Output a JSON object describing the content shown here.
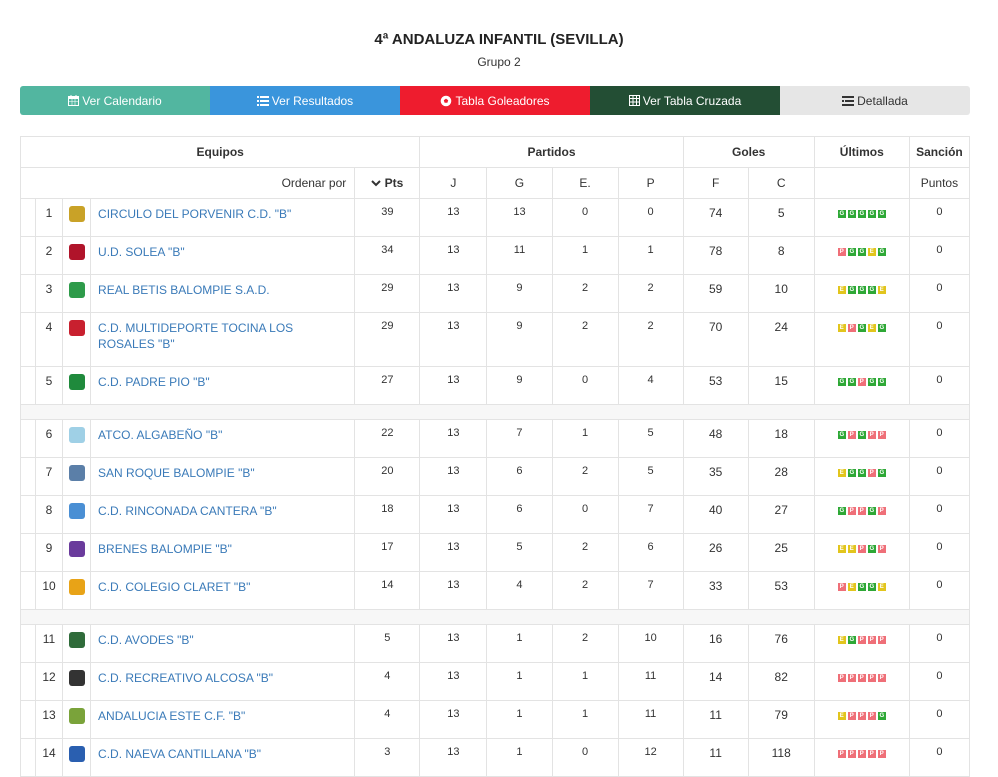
{
  "header": {
    "title": "4ª ANDALUZA INFANTIL (SEVILLA)",
    "subtitle": "Grupo 2"
  },
  "tabs": [
    {
      "label": "Ver Calendario",
      "icon": "calendar-icon",
      "color": "#52b6a0"
    },
    {
      "label": "Ver Resultados",
      "icon": "list-icon",
      "color": "#3a95dc"
    },
    {
      "label": "Tabla Goleadores",
      "icon": "soccer-ball-icon",
      "color": "#ee1c2e"
    },
    {
      "label": "Ver Tabla Cruzada",
      "icon": "grid-icon",
      "color": "#234e34"
    },
    {
      "label": "Detallada",
      "icon": "detail-list-icon",
      "color": "#e6e6e6"
    }
  ],
  "table_headers": {
    "equipos": "Equipos",
    "partidos": "Partidos",
    "goles": "Goles",
    "ultimos": "Últimos",
    "sancion": "Sanción",
    "ordenar": "Ordenar por",
    "pts": "Pts",
    "j": "J",
    "g": "G",
    "e": "E.",
    "p": "P",
    "f": "F",
    "c": "C",
    "puntos": "Puntos"
  },
  "result_colors": {
    "G": "#2ea836",
    "E": "#e2c51d",
    "P": "#ef6f78"
  },
  "teams": [
    {
      "pos": "1",
      "name": "CIRCULO DEL PORVENIR C.D. \"B\"",
      "pts": "39",
      "j": "13",
      "g": "13",
      "e": "0",
      "p": "0",
      "f": "74",
      "c": "5",
      "last": [
        "G",
        "G",
        "G",
        "G",
        "G"
      ],
      "sancion": "0",
      "crest": "#c9a227"
    },
    {
      "pos": "2",
      "name": "U.D. SOLEA \"B\"",
      "pts": "34",
      "j": "13",
      "g": "11",
      "e": "1",
      "p": "1",
      "f": "78",
      "c": "8",
      "last": [
        "P",
        "G",
        "G",
        "E",
        "G"
      ],
      "sancion": "0",
      "crest": "#b0142a"
    },
    {
      "pos": "3",
      "name": "REAL BETIS BALOMPIE S.A.D.",
      "pts": "29",
      "j": "13",
      "g": "9",
      "e": "2",
      "p": "2",
      "f": "59",
      "c": "10",
      "last": [
        "E",
        "G",
        "G",
        "G",
        "E"
      ],
      "sancion": "0",
      "crest": "#2e9b4a"
    },
    {
      "pos": "4",
      "name": "C.D. MULTIDEPORTE TOCINA LOS ROSALES \"B\"",
      "pts": "29",
      "j": "13",
      "g": "9",
      "e": "2",
      "p": "2",
      "f": "70",
      "c": "24",
      "last": [
        "E",
        "P",
        "G",
        "E",
        "G"
      ],
      "sancion": "0",
      "crest": "#c8202f"
    },
    {
      "pos": "5",
      "name": "C.D. PADRE PIO \"B\"",
      "pts": "27",
      "j": "13",
      "g": "9",
      "e": "0",
      "p": "4",
      "f": "53",
      "c": "15",
      "last": [
        "G",
        "G",
        "P",
        "G",
        "G"
      ],
      "sancion": "0",
      "crest": "#1f8a3c"
    },
    {
      "pos": "6",
      "name": "ATCO. ALGABEÑO \"B\"",
      "pts": "22",
      "j": "13",
      "g": "7",
      "e": "1",
      "p": "5",
      "f": "48",
      "c": "18",
      "last": [
        "G",
        "P",
        "G",
        "P",
        "P"
      ],
      "sancion": "0",
      "crest": "#9fd0e6"
    },
    {
      "pos": "7",
      "name": "SAN ROQUE BALOMPIE \"B\"",
      "pts": "20",
      "j": "13",
      "g": "6",
      "e": "2",
      "p": "5",
      "f": "35",
      "c": "28",
      "last": [
        "E",
        "G",
        "G",
        "P",
        "G"
      ],
      "sancion": "0",
      "crest": "#5b7fa8"
    },
    {
      "pos": "8",
      "name": "C.D. RINCONADA CANTERA \"B\"",
      "pts": "18",
      "j": "13",
      "g": "6",
      "e": "0",
      "p": "7",
      "f": "40",
      "c": "27",
      "last": [
        "G",
        "P",
        "P",
        "G",
        "P"
      ],
      "sancion": "0",
      "crest": "#4a8fd4"
    },
    {
      "pos": "9",
      "name": "BRENES BALOMPIE \"B\"",
      "pts": "17",
      "j": "13",
      "g": "5",
      "e": "2",
      "p": "6",
      "f": "26",
      "c": "25",
      "last": [
        "E",
        "E",
        "P",
        "G",
        "P"
      ],
      "sancion": "0",
      "crest": "#6a3b9c"
    },
    {
      "pos": "10",
      "name": "C.D. COLEGIO CLARET \"B\"",
      "pts": "14",
      "j": "13",
      "g": "4",
      "e": "2",
      "p": "7",
      "f": "33",
      "c": "53",
      "last": [
        "P",
        "E",
        "G",
        "G",
        "E"
      ],
      "sancion": "0",
      "crest": "#e8a317"
    },
    {
      "pos": "11",
      "name": "C.D. AVODES \"B\"",
      "pts": "5",
      "j": "13",
      "g": "1",
      "e": "2",
      "p": "10",
      "f": "16",
      "c": "76",
      "last": [
        "E",
        "G",
        "P",
        "P",
        "P"
      ],
      "sancion": "0",
      "crest": "#2f6b3a"
    },
    {
      "pos": "12",
      "name": "C.D. RECREATIVO ALCOSA \"B\"",
      "pts": "4",
      "j": "13",
      "g": "1",
      "e": "1",
      "p": "11",
      "f": "14",
      "c": "82",
      "last": [
        "P",
        "P",
        "P",
        "P",
        "P"
      ],
      "sancion": "0",
      "crest": "#333333"
    },
    {
      "pos": "13",
      "name": "ANDALUCIA ESTE C.F. \"B\"",
      "pts": "4",
      "j": "13",
      "g": "1",
      "e": "1",
      "p": "11",
      "f": "11",
      "c": "79",
      "last": [
        "E",
        "P",
        "P",
        "P",
        "G"
      ],
      "sancion": "0",
      "crest": "#7aa33a"
    },
    {
      "pos": "14",
      "name": "C.D. NAEVA CANTILLANA \"B\"",
      "pts": "3",
      "j": "13",
      "g": "1",
      "e": "0",
      "p": "12",
      "f": "11",
      "c": "118",
      "last": [
        "P",
        "P",
        "P",
        "P",
        "P"
      ],
      "sancion": "0",
      "crest": "#2a5fb0"
    }
  ]
}
